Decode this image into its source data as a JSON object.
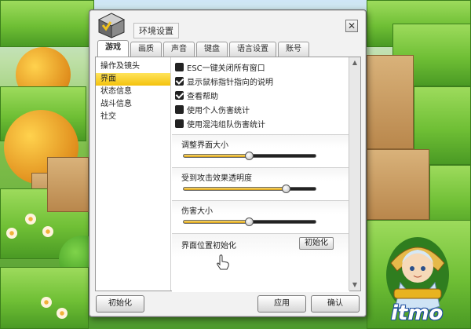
{
  "window": {
    "title": "环境设置",
    "close_glyph": "✕"
  },
  "tabs": [
    {
      "label": "游戏",
      "active": true
    },
    {
      "label": "画质",
      "active": false
    },
    {
      "label": "声音",
      "active": false
    },
    {
      "label": "键盘",
      "active": false
    },
    {
      "label": "语言设置",
      "active": false
    },
    {
      "label": "账号",
      "active": false
    }
  ],
  "categories": [
    {
      "label": "操作及镜头",
      "selected": false
    },
    {
      "label": "界面",
      "selected": true
    },
    {
      "label": "状态信息",
      "selected": false
    },
    {
      "label": "战斗信息",
      "selected": false
    },
    {
      "label": "社交",
      "selected": false
    }
  ],
  "checkboxes": [
    {
      "label": "ESC一键关闭所有窗口",
      "checked": false
    },
    {
      "label": "显示鼠标指针指向的说明",
      "checked": true
    },
    {
      "label": "查看帮助",
      "checked": true
    },
    {
      "label": "使用个人伤害统计",
      "checked": false
    },
    {
      "label": "使用混沌组队伤害统计",
      "checked": false
    }
  ],
  "sliders": [
    {
      "label": "调整界面大小",
      "value": 0.5
    },
    {
      "label": "受到攻击效果透明度",
      "value": 0.78
    },
    {
      "label": "伤害大小",
      "value": 0.5
    }
  ],
  "reset_position": {
    "label": "界面位置初始化",
    "button": "初始化"
  },
  "footer": {
    "reset_label": "初始化",
    "apply_label": "应用",
    "confirm_label": "确认"
  },
  "watermark": {
    "logo_text": "itmo"
  },
  "colors": {
    "selected_highlight": "#f4c20d",
    "slider_fill": "#e8b320"
  }
}
